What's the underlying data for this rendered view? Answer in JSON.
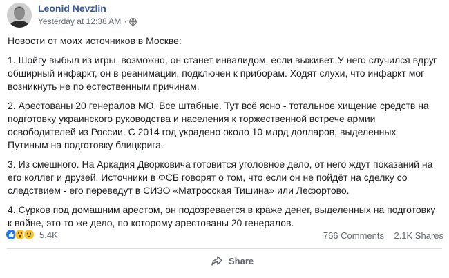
{
  "header": {
    "author": "Leonid Nevzlin",
    "timestamp": "Yesterday at 12:38 AM",
    "privacy_icon": "globe-icon",
    "more_icon": "more-options-icon"
  },
  "post": {
    "intro": "Новости от моих источников в Москве:",
    "paragraphs": [
      "1. Шойгу выбыл из игры, возможно, он станет инвалидом, если выживет. У него случился вдруг обширный инфаркт, он в реанимации, подключен к приборам. Ходят слухи, что инфаркт мог возникнуть не по естественным причинам.",
      "2. Арестованы 20 генералов МО. Все штабные. Тут всё ясно - тотальное хищение средств на подготовку украинского руководства и населения к торжественной встрече армии освободителей из России. С 2014 год украдено около 10 млрд долларов, выделенных Путиным на подготовку блицкрига.",
      "3. Из смешного. На Аркадия Дворковича готовится уголовное дело, от него ждут показаний на его коллег и друзей. Источники в ФСБ говорят о том, что если он не пойдёт на сделку со следствием - его переведут в СИЗО «Матросская Тишина» или Лефортово.",
      "4. Сурков под домашним арестом, он подозревается в краже денег, выделенных на подготовку к войне, это то же дело, по которому арестованы 20 генералов."
    ]
  },
  "stats": {
    "reactions": [
      "like-icon",
      "wow-icon",
      "sad-icon"
    ],
    "reaction_count": "5.4K",
    "comments": "766 Comments",
    "shares": "2.1K Shares"
  },
  "actions": {
    "share_label": "Share",
    "share_icon": "share-arrow-icon"
  },
  "colors": {
    "author_link": "#385898",
    "secondary_text": "#606770",
    "like_blue": "#2078f4",
    "emoji_yellow": "#f7c531"
  }
}
